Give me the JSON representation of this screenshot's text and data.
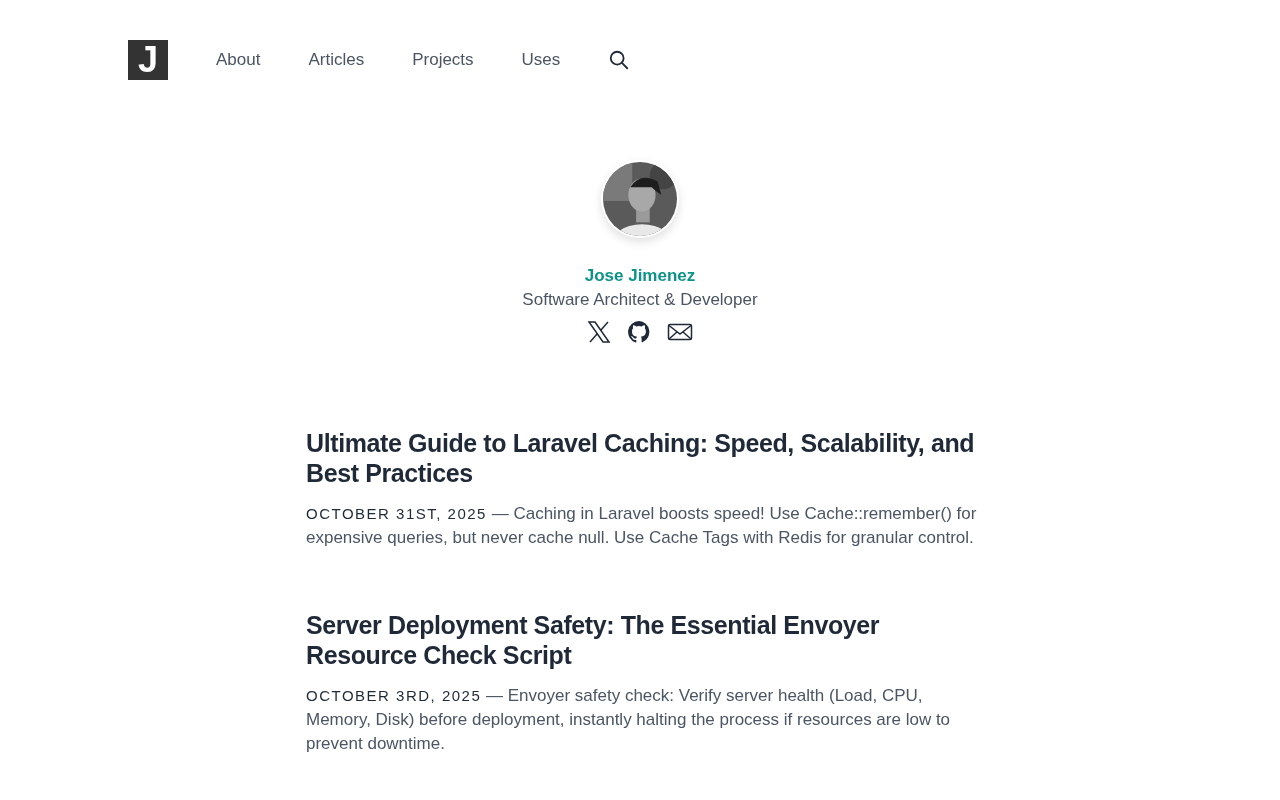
{
  "logo": {
    "letter": "J"
  },
  "nav": [
    {
      "label": "About"
    },
    {
      "label": "Articles"
    },
    {
      "label": "Projects"
    },
    {
      "label": "Uses"
    }
  ],
  "profile": {
    "name": "Jose Jimenez",
    "role": "Software Architect & Developer"
  },
  "articles": [
    {
      "title": "Ultimate Guide to Laravel Caching: Speed, Scalability, and Best Practices",
      "date": "OCTOBER 31ST, 2025",
      "summary": "— Caching in Laravel boosts speed! Use Cache::remember() for expensive queries, but never cache null. Use Cache Tags with Redis for granular control."
    },
    {
      "title": "Server Deployment Safety: The Essential Envoyer Resource Check Script",
      "date": "OCTOBER 3RD, 2025",
      "summary": "— Envoyer safety check: Verify server health (Load, CPU, Memory, Disk) before deployment, instantly halting the process if resources are low to prevent downtime."
    }
  ]
}
